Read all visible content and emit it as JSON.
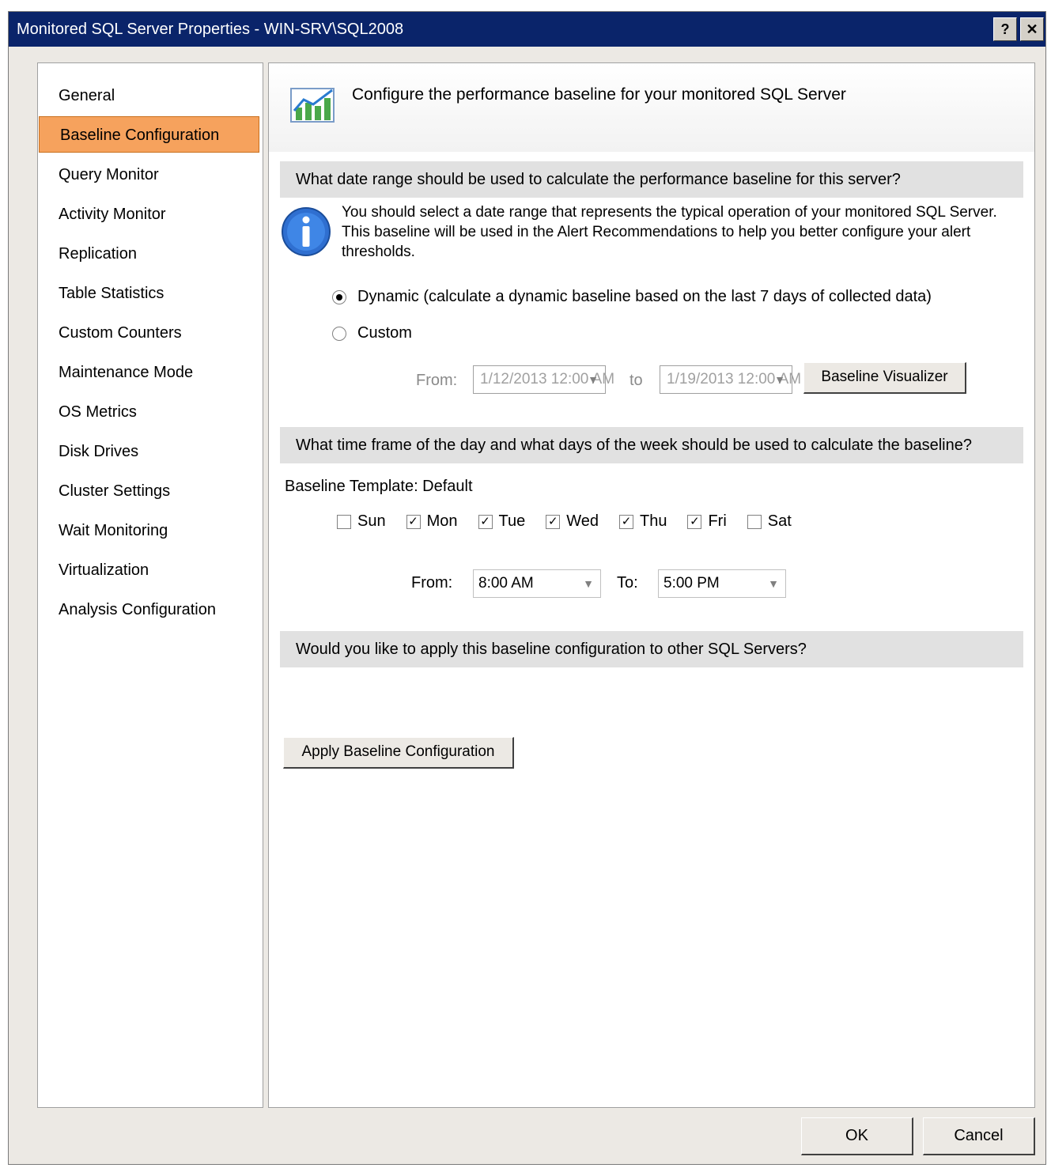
{
  "window": {
    "title": "Monitored SQL Server Properties - WIN-SRV\\SQL2008",
    "help_glyph": "?",
    "close_glyph": "✕"
  },
  "sidebar": {
    "items": [
      {
        "label": "General"
      },
      {
        "label": "Baseline Configuration"
      },
      {
        "label": "Query Monitor"
      },
      {
        "label": "Activity Monitor"
      },
      {
        "label": "Replication"
      },
      {
        "label": "Table Statistics"
      },
      {
        "label": "Custom Counters"
      },
      {
        "label": "Maintenance Mode"
      },
      {
        "label": "OS Metrics"
      },
      {
        "label": "Disk Drives"
      },
      {
        "label": "Cluster Settings"
      },
      {
        "label": "Wait Monitoring"
      },
      {
        "label": "Virtualization"
      },
      {
        "label": "Analysis Configuration"
      }
    ],
    "selected_index": 1
  },
  "header": {
    "icon": "chart-icon",
    "text": "Configure the performance baseline for your monitored SQL Server"
  },
  "section1": {
    "title": "What date range should be used to calculate the performance baseline for this server?",
    "info_icon": "info-icon",
    "info_text": "You should select a date range that represents the typical operation of your monitored SQL Server. This baseline will be used in the Alert Recommendations to help you better configure your alert thresholds.",
    "radio_dynamic": "Dynamic (calculate a dynamic baseline based on the last 7 days of collected data)",
    "radio_custom": "Custom",
    "from_label": "From:",
    "from_value": "1/12/2013 12:00 AM",
    "to_label": "to",
    "to_value": "1/19/2013 12:00 AM",
    "button": "Baseline Visualizer"
  },
  "section2": {
    "title": "What time frame of the day and what days of the week should be used to calculate the baseline?",
    "template_label": "Baseline Template: Default",
    "days": [
      {
        "label": "Sun",
        "checked": false
      },
      {
        "label": "Mon",
        "checked": true
      },
      {
        "label": "Tue",
        "checked": true
      },
      {
        "label": "Wed",
        "checked": true
      },
      {
        "label": "Thu",
        "checked": true
      },
      {
        "label": "Fri",
        "checked": true
      },
      {
        "label": "Sat",
        "checked": false
      }
    ],
    "from_label": "From:",
    "from_time": "8:00 AM",
    "to_label": "To:",
    "to_time": "5:00 PM"
  },
  "section3": {
    "title": "Would you like to apply this baseline configuration to other SQL Servers?",
    "button": "Apply Baseline Configuration"
  },
  "footer": {
    "ok": "OK",
    "cancel": "Cancel"
  },
  "colors": {
    "titlebar": "#0a246a",
    "selected": "#f6a25d",
    "section_bar": "#e1e1e1"
  }
}
